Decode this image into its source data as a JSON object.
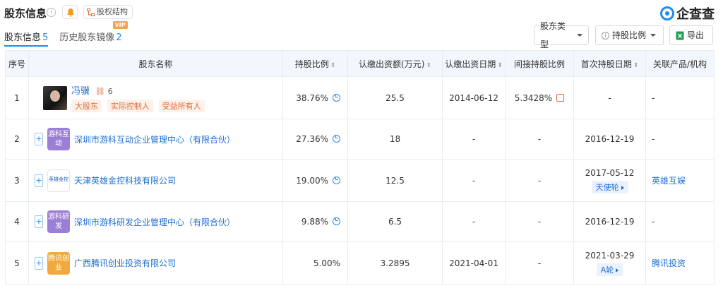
{
  "header": {
    "title": "股东信息",
    "struct_label": "股权结构",
    "logo_text": "企查查"
  },
  "tabs": [
    {
      "label": "股东信息",
      "count": "5",
      "active": true
    },
    {
      "label": "历史股东镜像",
      "count": "2",
      "vip": "VIP"
    }
  ],
  "toolbar": {
    "type_label": "股东类型",
    "ratio_label": "持股比例",
    "export_label": "导出"
  },
  "columns": [
    "序号",
    "股东名称",
    "持股比例",
    "认缴出资额(万元)",
    "认缴出资日期",
    "间接持股比例",
    "首次持股日期",
    "关联产品/机构"
  ],
  "rows": [
    {
      "index": "1",
      "name": "冯骥",
      "related_count": "6",
      "tags": [
        "大股东",
        "实际控制人",
        "受益所有人"
      ],
      "ratio": "38.76%",
      "amount": "25.5",
      "date": "2014-06-12",
      "indirect": "5.3428%",
      "first_date": "-",
      "round": "",
      "product": "-"
    },
    {
      "index": "2",
      "name": "深圳市游科互动企业管理中心（有限合伙）",
      "logo_text": "游科互动",
      "logo_color": "#9b7fd6",
      "ratio": "27.36%",
      "amount": "18",
      "date": "-",
      "indirect": "-",
      "first_date": "2016-12-19",
      "round": "",
      "product": "-"
    },
    {
      "index": "3",
      "name": "天津英雄金控科技有限公司",
      "logo_text": "英雄金控",
      "ratio": "19.00%",
      "amount": "12.5",
      "date": "-",
      "indirect": "-",
      "first_date": "2017-05-12",
      "round": "天使轮",
      "product": "英雄互娱"
    },
    {
      "index": "4",
      "name": "深圳市游科研发企业管理中心（有限合伙）",
      "logo_text": "游科研发",
      "logo_color": "#9b7fd6",
      "ratio": "9.88%",
      "amount": "6.5",
      "date": "-",
      "indirect": "-",
      "first_date": "2016-12-19",
      "round": "",
      "product": "-"
    },
    {
      "index": "5",
      "name": "广西腾讯创业投资有限公司",
      "logo_text": "腾讯创业",
      "logo_color": "#f0a93c",
      "ratio": "5.00%",
      "amount": "3.2895",
      "date": "2021-04-01",
      "indirect": "-",
      "first_date": "2021-03-29",
      "round": "A轮",
      "product": "腾讯投资"
    }
  ]
}
